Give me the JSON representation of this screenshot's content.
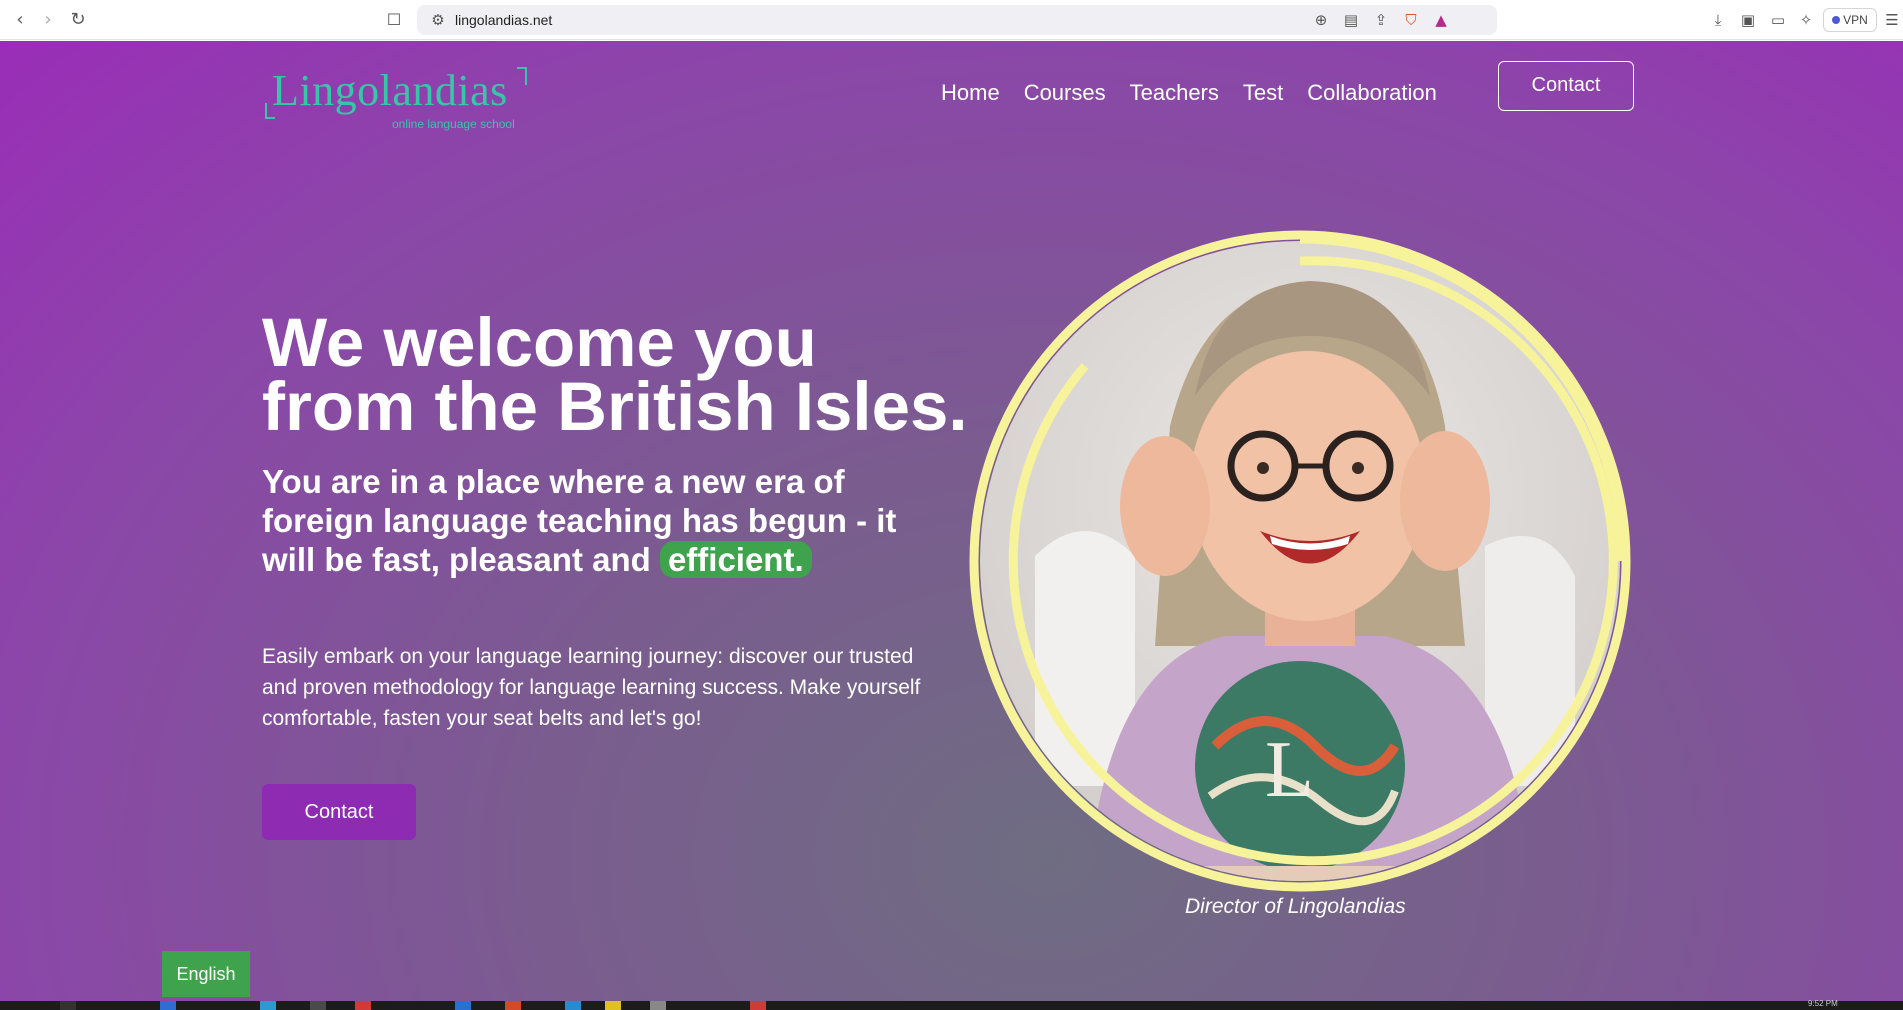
{
  "browser": {
    "back_icon": "chevron-left-icon",
    "forward_icon": "chevron-right-icon",
    "reload_icon": "reload-icon",
    "url": "lingolandias.net",
    "vpn_label": "VPN"
  },
  "site": {
    "logo_word": "Lingolandias",
    "logo_tagline": "online language school",
    "nav": [
      "Home",
      "Courses",
      "Teachers",
      "Test",
      "Collaboration"
    ],
    "contact_top": "Contact"
  },
  "hero": {
    "title_line1": "We welcome you",
    "title_line2": "from the British Isles.",
    "sub_text": "You are in a place where a new era of foreign language teaching has begun - it will be fast, pleasant and",
    "sub_highlight": "efficient.",
    "body": "Easily embark on your language learning journey: discover our trusted and proven methodology for language learning success. Make yourself comfortable, fasten your seat belts and let's go!",
    "contact_button": "Contact",
    "caption": "Director of Lingolandias"
  },
  "language_button": "English",
  "colors": {
    "accent_green": "#3fa34d",
    "logo_teal": "#37c7a8",
    "purple": "#8e2bb3",
    "ring_yellow": "#f7f39a"
  },
  "taskbar": {
    "time": "9:52 PM"
  }
}
